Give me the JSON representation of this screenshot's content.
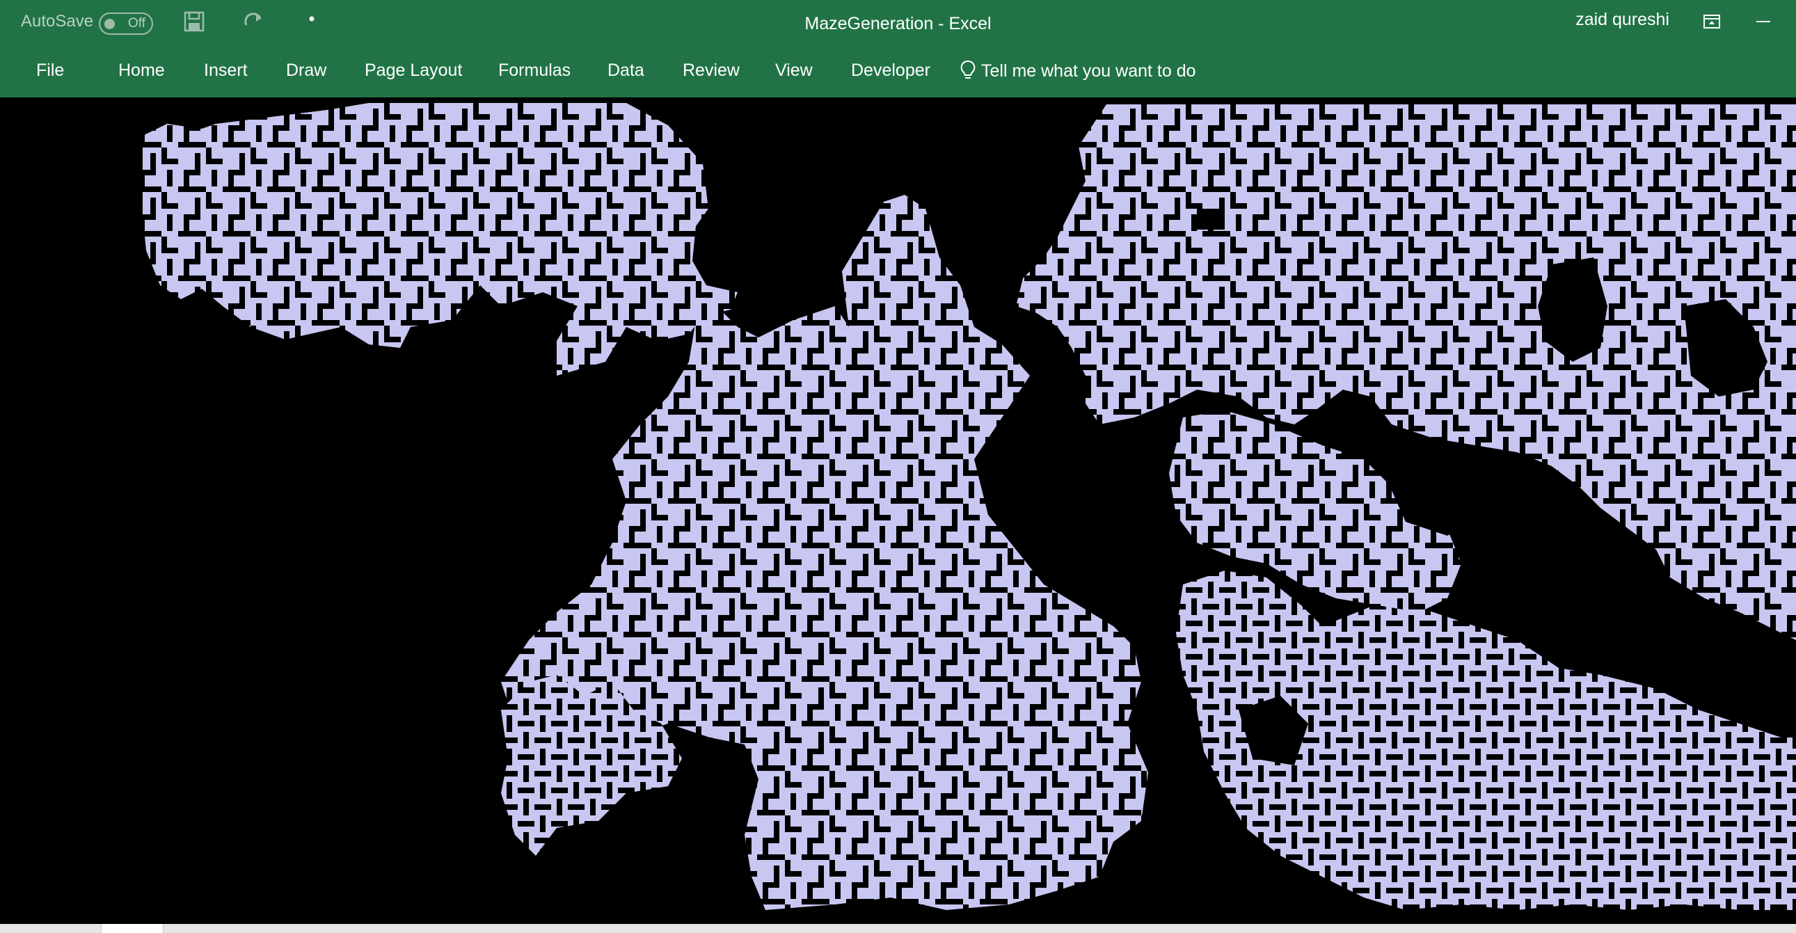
{
  "titlebar": {
    "autosave_label": "AutoSave",
    "autosave_state": "Off",
    "window_title": "MazeGeneration  -  Excel",
    "user_name": "zaid qureshi",
    "icons": [
      "save-icon",
      "redo-icon",
      "customize-qat-icon",
      "ribbon-display-options-icon",
      "minimize-icon"
    ]
  },
  "ribbon": {
    "tabs": [
      "File",
      "Home",
      "Insert",
      "Draw",
      "Page Layout",
      "Formulas",
      "Data",
      "Review",
      "View",
      "Developer"
    ],
    "tell_me": "Tell me what you want to do"
  },
  "colors": {
    "excel_green": "#217346",
    "maze_fill": "#c7c7f1",
    "maze_wall": "#000000"
  }
}
